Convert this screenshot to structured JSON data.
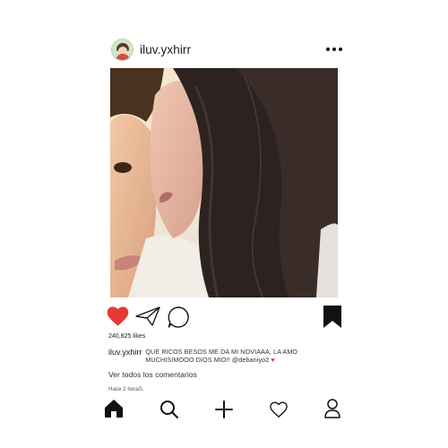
{
  "post": {
    "username": "iluv.yxhirr",
    "likes": "240,825 likes",
    "caption_username": "iluv.yxhirr",
    "caption_text": "QUE RICOS BESOS ME DA MI NOVIAAA, LA AMO MUCHISIMOOO DIOS MIO!! @debaniyo2",
    "caption_emoji": "♥",
    "view_comments": "Ver todos los comentarios",
    "time_ago": "Hace 2 horaS."
  },
  "photo": {
    "description_icon": "photo-image"
  },
  "icons": {
    "more": "more-dots-icon",
    "like": "heart-icon",
    "share": "paper-plane-icon",
    "comment": "comment-bubble-icon",
    "save": "bookmark-icon",
    "nav": [
      "home-icon",
      "search-icon",
      "plus-icon",
      "heart-outline-icon",
      "profile-icon"
    ]
  },
  "colors": {
    "like": "#e53935",
    "caption_heart": "#e0333d",
    "text": "#1a1a1a"
  }
}
